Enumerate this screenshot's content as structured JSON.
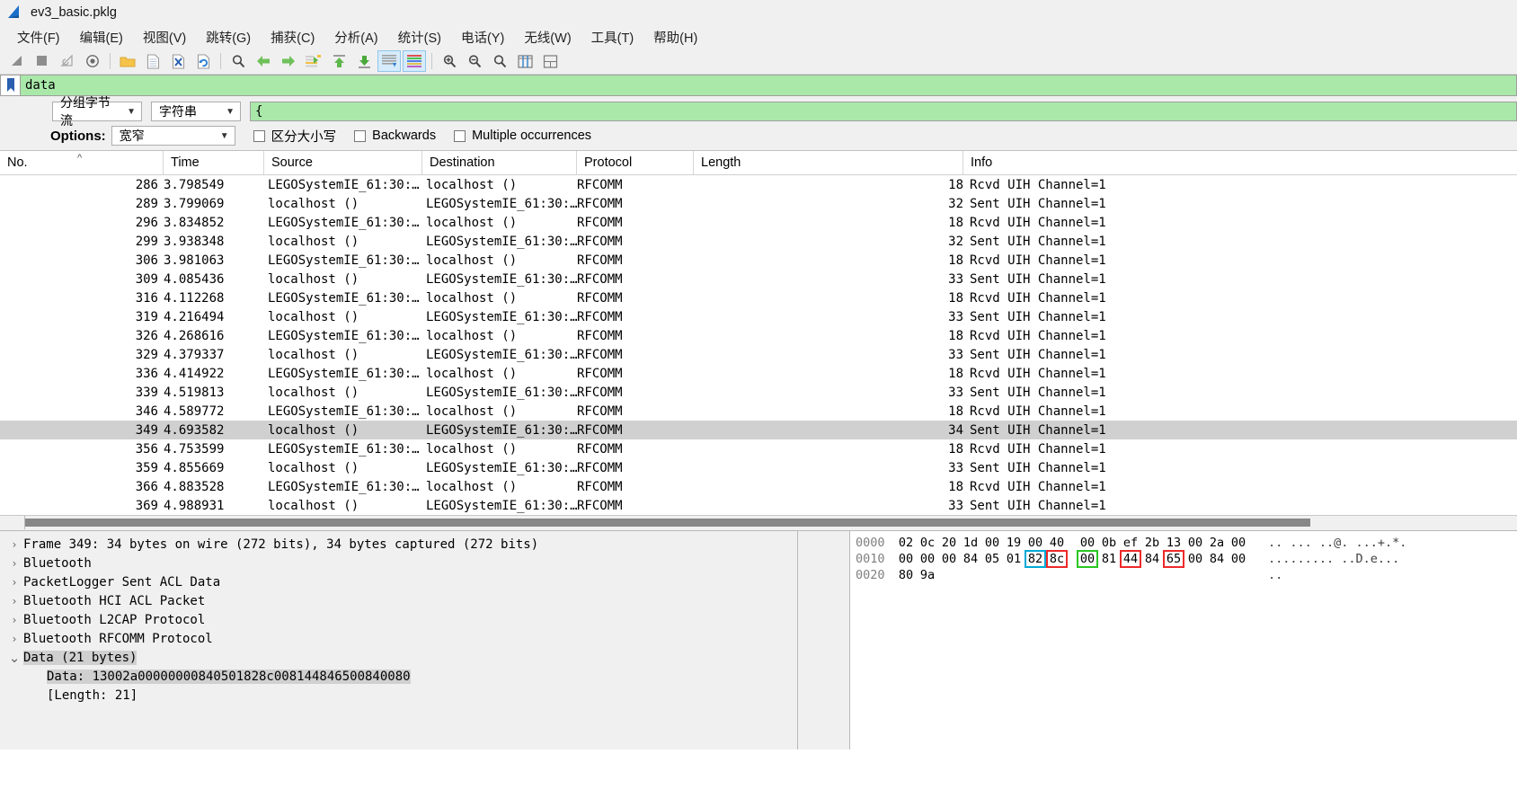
{
  "window": {
    "title": "ev3_basic.pklg",
    "icon": "wireshark-fin-icon"
  },
  "menu": [
    {
      "label": "文件(F)",
      "name": "menu-file"
    },
    {
      "label": "编辑(E)",
      "name": "menu-edit"
    },
    {
      "label": "视图(V)",
      "name": "menu-view"
    },
    {
      "label": "跳转(G)",
      "name": "menu-go"
    },
    {
      "label": "捕获(C)",
      "name": "menu-capture"
    },
    {
      "label": "分析(A)",
      "name": "menu-analyze"
    },
    {
      "label": "统计(S)",
      "name": "menu-statistics"
    },
    {
      "label": "电话(Y)",
      "name": "menu-telephony"
    },
    {
      "label": "无线(W)",
      "name": "menu-wireless"
    },
    {
      "label": "工具(T)",
      "name": "menu-tools"
    },
    {
      "label": "帮助(H)",
      "name": "menu-help"
    }
  ],
  "toolbar": [
    {
      "name": "start-capture-icon"
    },
    {
      "name": "stop-capture-icon"
    },
    {
      "name": "restart-capture-icon"
    },
    {
      "name": "capture-options-icon"
    },
    {
      "sep": true
    },
    {
      "name": "open-file-icon"
    },
    {
      "name": "save-file-icon"
    },
    {
      "name": "close-file-icon"
    },
    {
      "name": "reload-file-icon"
    },
    {
      "sep": true
    },
    {
      "name": "find-packet-icon"
    },
    {
      "name": "go-back-icon"
    },
    {
      "name": "go-forward-icon"
    },
    {
      "name": "go-to-packet-icon"
    },
    {
      "name": "go-first-packet-icon"
    },
    {
      "name": "go-last-packet-icon"
    },
    {
      "name": "auto-scroll-icon",
      "active": true
    },
    {
      "name": "colorize-packets-icon",
      "active": true
    },
    {
      "sep2": true
    },
    {
      "name": "zoom-in-icon"
    },
    {
      "name": "zoom-out-icon"
    },
    {
      "name": "zoom-reset-icon"
    },
    {
      "name": "resize-columns-icon"
    },
    {
      "name": "layout-icon"
    }
  ],
  "display_filter": {
    "value": "data",
    "bookmark_icon": "bookmark-icon",
    "background": "#a9e8a9"
  },
  "find": {
    "search_in": "分组字节流",
    "search_type": "字符串",
    "find_value": "{",
    "options_label": "Options:",
    "narrow_wide": "宽窄",
    "case_sensitive_label": "区分大小写",
    "backwards_label": "Backwards",
    "multiple_label": "Multiple occurrences",
    "case_sensitive_checked": false,
    "backwards_checked": false,
    "multiple_checked": false
  },
  "packet_list": {
    "columns": [
      "No.",
      "Time",
      "Source",
      "Destination",
      "Protocol",
      "Length",
      "Info"
    ],
    "sort_column": "No.",
    "sort_direction": "ascending",
    "selected_index": 13,
    "rows": [
      {
        "no": "286",
        "time": "3.798549",
        "src": "LEGOSystemIE_61:30:…",
        "dst": "localhost ()",
        "proto": "RFCOMM",
        "len": "18",
        "info": "Rcvd UIH Channel=1"
      },
      {
        "no": "289",
        "time": "3.799069",
        "src": "localhost ()",
        "dst": "LEGOSystemIE_61:30:…",
        "proto": "RFCOMM",
        "len": "32",
        "info": "Sent UIH Channel=1"
      },
      {
        "no": "296",
        "time": "3.834852",
        "src": "LEGOSystemIE_61:30:…",
        "dst": "localhost ()",
        "proto": "RFCOMM",
        "len": "18",
        "info": "Rcvd UIH Channel=1"
      },
      {
        "no": "299",
        "time": "3.938348",
        "src": "localhost ()",
        "dst": "LEGOSystemIE_61:30:…",
        "proto": "RFCOMM",
        "len": "32",
        "info": "Sent UIH Channel=1"
      },
      {
        "no": "306",
        "time": "3.981063",
        "src": "LEGOSystemIE_61:30:…",
        "dst": "localhost ()",
        "proto": "RFCOMM",
        "len": "18",
        "info": "Rcvd UIH Channel=1"
      },
      {
        "no": "309",
        "time": "4.085436",
        "src": "localhost ()",
        "dst": "LEGOSystemIE_61:30:…",
        "proto": "RFCOMM",
        "len": "33",
        "info": "Sent UIH Channel=1"
      },
      {
        "no": "316",
        "time": "4.112268",
        "src": "LEGOSystemIE_61:30:…",
        "dst": "localhost ()",
        "proto": "RFCOMM",
        "len": "18",
        "info": "Rcvd UIH Channel=1"
      },
      {
        "no": "319",
        "time": "4.216494",
        "src": "localhost ()",
        "dst": "LEGOSystemIE_61:30:…",
        "proto": "RFCOMM",
        "len": "33",
        "info": "Sent UIH Channel=1"
      },
      {
        "no": "326",
        "time": "4.268616",
        "src": "LEGOSystemIE_61:30:…",
        "dst": "localhost ()",
        "proto": "RFCOMM",
        "len": "18",
        "info": "Rcvd UIH Channel=1"
      },
      {
        "no": "329",
        "time": "4.379337",
        "src": "localhost ()",
        "dst": "LEGOSystemIE_61:30:…",
        "proto": "RFCOMM",
        "len": "33",
        "info": "Sent UIH Channel=1"
      },
      {
        "no": "336",
        "time": "4.414922",
        "src": "LEGOSystemIE_61:30:…",
        "dst": "localhost ()",
        "proto": "RFCOMM",
        "len": "18",
        "info": "Rcvd UIH Channel=1"
      },
      {
        "no": "339",
        "time": "4.519813",
        "src": "localhost ()",
        "dst": "LEGOSystemIE_61:30:…",
        "proto": "RFCOMM",
        "len": "33",
        "info": "Sent UIH Channel=1"
      },
      {
        "no": "346",
        "time": "4.589772",
        "src": "LEGOSystemIE_61:30:…",
        "dst": "localhost ()",
        "proto": "RFCOMM",
        "len": "18",
        "info": "Rcvd UIH Channel=1"
      },
      {
        "no": "349",
        "time": "4.693582",
        "src": "localhost ()",
        "dst": "LEGOSystemIE_61:30:…",
        "proto": "RFCOMM",
        "len": "34",
        "info": "Sent UIH Channel=1"
      },
      {
        "no": "356",
        "time": "4.753599",
        "src": "LEGOSystemIE_61:30:…",
        "dst": "localhost ()",
        "proto": "RFCOMM",
        "len": "18",
        "info": "Rcvd UIH Channel=1"
      },
      {
        "no": "359",
        "time": "4.855669",
        "src": "localhost ()",
        "dst": "LEGOSystemIE_61:30:…",
        "proto": "RFCOMM",
        "len": "33",
        "info": "Sent UIH Channel=1"
      },
      {
        "no": "366",
        "time": "4.883528",
        "src": "LEGOSystemIE_61:30:…",
        "dst": "localhost ()",
        "proto": "RFCOMM",
        "len": "18",
        "info": "Rcvd UIH Channel=1"
      },
      {
        "no": "369",
        "time": "4.988931",
        "src": "localhost ()",
        "dst": "LEGOSystemIE_61:30:…",
        "proto": "RFCOMM",
        "len": "33",
        "info": "Sent UIH Channel=1"
      }
    ]
  },
  "packet_details": [
    {
      "twisty": "collapsed",
      "label": "Frame 349: 34 bytes on wire (272 bits), 34 bytes captured (272 bits)",
      "indent": 0,
      "selected": false
    },
    {
      "twisty": "collapsed",
      "label": "Bluetooth",
      "indent": 0,
      "selected": false
    },
    {
      "twisty": "collapsed",
      "label": "PacketLogger Sent ACL Data",
      "indent": 0,
      "selected": false
    },
    {
      "twisty": "collapsed",
      "label": "Bluetooth HCI ACL Packet",
      "indent": 0,
      "selected": false
    },
    {
      "twisty": "collapsed",
      "label": "Bluetooth L2CAP Protocol",
      "indent": 0,
      "selected": false
    },
    {
      "twisty": "collapsed",
      "label": "Bluetooth RFCOMM Protocol",
      "indent": 0,
      "selected": false
    },
    {
      "twisty": "expanded",
      "label": "Data (21 bytes)",
      "indent": 0,
      "selected": true
    },
    {
      "twisty": "none",
      "label": "Data: 13002a00000000840501828c008144846500840080",
      "indent": 1,
      "selected": true
    },
    {
      "twisty": "none",
      "label": "[Length: 21]",
      "indent": 1,
      "selected": false
    }
  ],
  "hex_dump": {
    "lines": [
      {
        "offset": "0000",
        "bytes": [
          {
            "v": "02"
          },
          {
            "v": "0c"
          },
          {
            "v": "20"
          },
          {
            "v": "1d"
          },
          {
            "v": "00"
          },
          {
            "v": "19"
          },
          {
            "v": "00"
          },
          {
            "v": "40"
          },
          {
            "v": "00"
          },
          {
            "v": "0b"
          },
          {
            "v": "ef"
          },
          {
            "v": "2b"
          },
          {
            "v": "13"
          },
          {
            "v": "00"
          },
          {
            "v": "2a"
          },
          {
            "v": "00"
          }
        ],
        "ascii": ".. ... ..@. ...+.*."
      },
      {
        "offset": "0010",
        "bytes": [
          {
            "v": "00"
          },
          {
            "v": "00"
          },
          {
            "v": "00"
          },
          {
            "v": "84"
          },
          {
            "v": "05"
          },
          {
            "v": "01"
          },
          {
            "v": "82",
            "box": "cyan"
          },
          {
            "v": "8c",
            "box": "red"
          },
          {
            "v": "00",
            "box": "green"
          },
          {
            "v": "81"
          },
          {
            "v": "44",
            "box": "red"
          },
          {
            "v": "84"
          },
          {
            "v": "65",
            "box": "red"
          },
          {
            "v": "00"
          },
          {
            "v": "84"
          },
          {
            "v": "00"
          }
        ],
        "ascii": "......... ..D.e..."
      },
      {
        "offset": "0020",
        "bytes": [
          {
            "v": "80"
          },
          {
            "v": "9a"
          }
        ],
        "ascii": ".."
      }
    ],
    "box_colors": {
      "cyan": "#00a8d6",
      "red": "#ef2929",
      "green": "#28c721"
    }
  }
}
